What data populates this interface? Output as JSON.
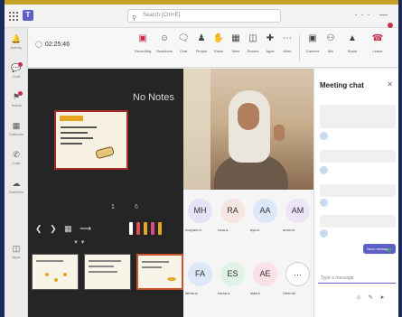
{
  "titlebar": {
    "search_placeholder": "Search (Ctrl+E)"
  },
  "toolbar": {
    "timer": "02:25:46",
    "buttons": [
      {
        "label": "Recording",
        "icon": "record-icon"
      },
      {
        "label": "Reactions",
        "icon": "reactions-icon"
      },
      {
        "label": "Chat",
        "icon": "chat-icon"
      },
      {
        "label": "People",
        "icon": "people-icon"
      },
      {
        "label": "Raise",
        "icon": "raise-hand-icon"
      },
      {
        "label": "View",
        "icon": "view-icon"
      },
      {
        "label": "Rooms",
        "icon": "rooms-icon"
      },
      {
        "label": "Apps",
        "icon": "apps-icon"
      },
      {
        "label": "More",
        "icon": "more-icon"
      },
      {
        "label": "Camera",
        "icon": "camera-icon"
      },
      {
        "label": "Mic",
        "icon": "mic-icon"
      },
      {
        "label": "Share",
        "icon": "share-icon"
      },
      {
        "label": "Leave",
        "icon": "leave-icon"
      }
    ]
  },
  "rail": [
    {
      "label": "Activity",
      "icon": "activity-icon"
    },
    {
      "label": "Chat",
      "icon": "chat-icon"
    },
    {
      "label": "Teams",
      "icon": "teams-icon"
    },
    {
      "label": "Calendar",
      "icon": "calendar-icon"
    },
    {
      "label": "Calls",
      "icon": "calls-icon"
    },
    {
      "label": "OneDrive",
      "icon": "onedrive-icon"
    },
    {
      "label": "Apps",
      "icon": "apps-icon"
    }
  ],
  "stage": {
    "notes_label": "No Notes",
    "slide_counter": "1",
    "slide_total": "6"
  },
  "participants": [
    {
      "initials": "MH",
      "name": "maryam.h.",
      "color": "#e6e1f6"
    },
    {
      "initials": "RA",
      "name": "rana.a.",
      "color": "#f6e6e1"
    },
    {
      "initials": "AA",
      "name": "aya.a.",
      "color": "#dce8f8"
    },
    {
      "initials": "AM",
      "name": "amal.m.",
      "color": "#ece4f7"
    },
    {
      "initials": "FA",
      "name": "fatma.a.",
      "color": "#dce8f8"
    },
    {
      "initials": "ES",
      "name": "esraa.s.",
      "color": "#e0f2e6"
    },
    {
      "initials": "AE",
      "name": "alaa.e.",
      "color": "#f9e1e6"
    },
    {
      "initials": "···",
      "name": "View all",
      "color": "#ffffff"
    }
  ],
  "chat": {
    "title": "Meeting chat",
    "new_messages": "New messages",
    "compose_placeholder": "Type a message"
  },
  "colors": {
    "accent": "#5b5fc7",
    "leave": "#c4314b",
    "stage_bg": "#252525"
  }
}
